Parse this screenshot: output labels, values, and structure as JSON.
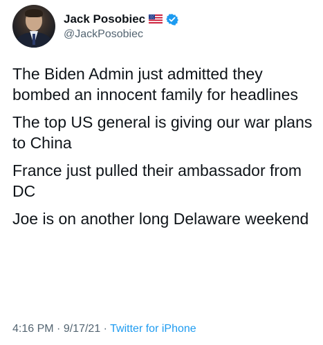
{
  "author": {
    "name": "Jack Posobiec",
    "handle": "@JackPosobiec",
    "flag_icon": "us-flag-icon",
    "verified_icon": "verified-badge-icon",
    "verified_color": "#1d9bf0"
  },
  "tweet": {
    "paragraphs": [
      "The Biden Admin just admitted they bombed an innocent family for headlines",
      "The top US general is giving our war plans to China",
      "France just pulled their ambassador from DC",
      "Joe is on another long Delaware weekend"
    ],
    "time": "4:16 PM",
    "separator": "·",
    "date": "9/17/21",
    "source": "Twitter for iPhone",
    "source_color": "#1d9bf0"
  }
}
